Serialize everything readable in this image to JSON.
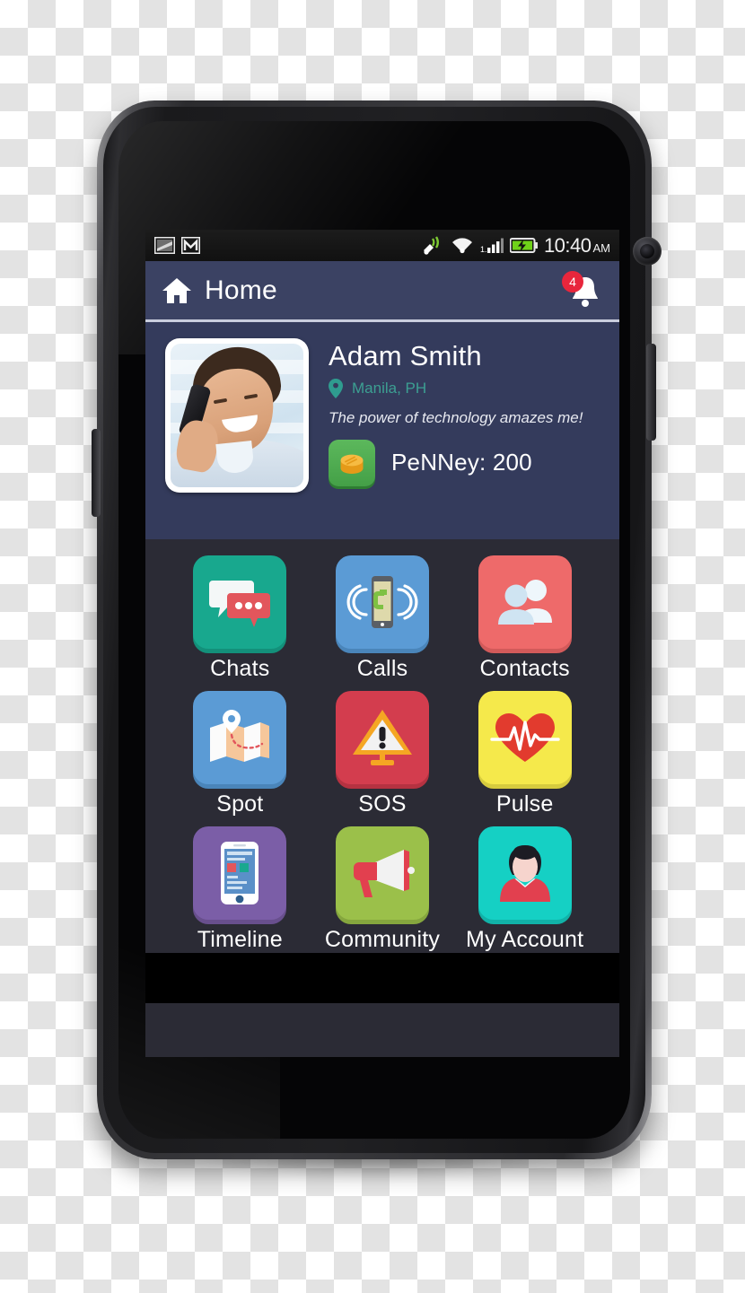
{
  "status_bar": {
    "icons_left": [
      "image-icon",
      "gmail-icon"
    ],
    "icons_right": [
      "gps-satellite-icon",
      "wifi-icon",
      "signal-bars-icon",
      "battery-charging-icon"
    ],
    "signal_label": "1.",
    "time": "10:40",
    "ampm": "AM"
  },
  "app_bar": {
    "home_icon": "home-icon",
    "title": "Home",
    "bell_icon": "bell-icon",
    "badge_count": "4",
    "bg_color": "#3b4263"
  },
  "profile": {
    "avatar_alt": "user-photo",
    "name": "Adam Smith",
    "location_icon": "location-pin-icon",
    "location": "Manila, PH",
    "status_message": "The power of technology amazes me!",
    "penney_icon": "coin-icon",
    "penney_label": "PeNNey: 200",
    "bg_color": "#343b5c",
    "location_color": "#3c9f92"
  },
  "apps": [
    {
      "label": "Chats",
      "icon": "chat-bubbles-icon",
      "color": "#18a88e",
      "shadow": "#13907a"
    },
    {
      "label": "Calls",
      "icon": "ringing-phone-icon",
      "color": "#5b9bd5",
      "shadow": "#4a85ba"
    },
    {
      "label": "Contacts",
      "icon": "people-icon",
      "color": "#ee6a6a",
      "shadow": "#d25a5a"
    },
    {
      "label": "Spot",
      "icon": "folded-map-icon",
      "color": "#5b9bd5",
      "shadow": "#4a85ba"
    },
    {
      "label": "SOS",
      "icon": "warning-sign-icon",
      "color": "#d33d4e",
      "shadow": "#b53241"
    },
    {
      "label": "Pulse",
      "icon": "heartbeat-icon",
      "color": "#f5e94b",
      "shadow": "#d6cb3e"
    },
    {
      "label": "Timeline",
      "icon": "smartphone-feed-icon",
      "color": "#7b5ea7",
      "shadow": "#684f8d"
    },
    {
      "label": "Community",
      "icon": "megaphone-icon",
      "color": "#9bc04a",
      "shadow": "#85a63e"
    },
    {
      "label": "My Account",
      "icon": "user-avatar-icon",
      "color": "#15d0c4",
      "shadow": "#11b2a8"
    }
  ],
  "device": {
    "type": "smartphone-mockup",
    "grid_bg_color": "#2b2b35"
  }
}
